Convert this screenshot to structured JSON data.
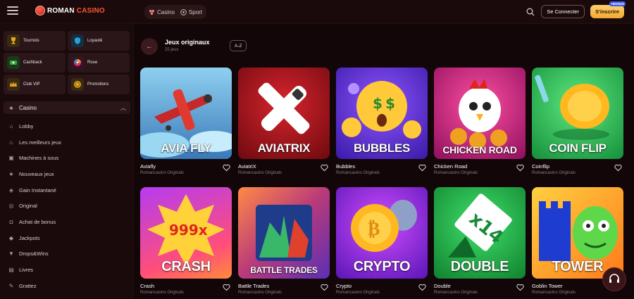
{
  "brand": {
    "part1": "ROMAN",
    "part2": "CASINO"
  },
  "header": {
    "tabs": [
      {
        "label": "Casino",
        "icon": "casino-icon"
      },
      {
        "label": "Sport",
        "icon": "soccer-ball-icon"
      }
    ],
    "login_label": "Se Connecter",
    "signup_label": "S'inscrire",
    "signup_badge": "+BONUS"
  },
  "sidebar": {
    "promos": [
      {
        "label": "Tournois",
        "icon": "trophy-icon",
        "color": "#e3a51f"
      },
      {
        "label": "Loyauté",
        "icon": "shield-icon",
        "color": "#2d9bd6"
      },
      {
        "label": "Cashback",
        "icon": "cash-icon",
        "color": "#39a23d"
      },
      {
        "label": "Roue",
        "icon": "wheel-icon",
        "color": "#d6326b"
      },
      {
        "label": "Club VIP",
        "icon": "crown-icon",
        "color": "#e3a51f"
      },
      {
        "label": "Promotions",
        "icon": "coin-icon",
        "color": "#e3a51f"
      }
    ],
    "casino_label": "Casino",
    "items": [
      {
        "label": "Lobby",
        "icon": "lobby-icon"
      },
      {
        "label": "Les meilleurs jeux",
        "icon": "flame-icon"
      },
      {
        "label": "Machines à sous",
        "icon": "slot-icon"
      },
      {
        "label": "Nouveaux jeux",
        "icon": "star-icon"
      },
      {
        "label": "Gain Instantané",
        "icon": "instant-icon"
      },
      {
        "label": "Original",
        "icon": "original-icon"
      },
      {
        "label": "Achat de bonus",
        "icon": "bag-icon"
      },
      {
        "label": "Jackpots",
        "icon": "jackpot-icon"
      },
      {
        "label": "Drops&Wins",
        "icon": "drops-icon"
      },
      {
        "label": "Livres",
        "icon": "book-icon"
      },
      {
        "label": "Grattez",
        "icon": "scratch-icon"
      }
    ]
  },
  "main": {
    "title": "Jeux originaux",
    "count": "25 jeux",
    "sort_label": "A-Z"
  },
  "games": [
    {
      "title": "Aviafly",
      "thumb_text": "AVIA FLY",
      "provider": "Romancasino Originals",
      "bg1": "#7ec3e8",
      "bg2": "#3a79b8"
    },
    {
      "title": "AviatriX",
      "thumb_text": "AVIATRIX",
      "provider": "Romancasino Originals",
      "bg1": "#c01a24",
      "bg2": "#6e0a10"
    },
    {
      "title": "Bubbles",
      "thumb_text": "BUBBLES",
      "provider": "Romancasino Originals",
      "bg1": "#7a3cf0",
      "bg2": "#3a1aa8"
    },
    {
      "title": "Chicken Road",
      "thumb_text": "CHICKEN ROAD",
      "provider": "Romancasino Originals",
      "bg1": "#ff3c8f",
      "bg2": "#a3126b"
    },
    {
      "title": "Coinflip",
      "thumb_text": "COIN FLIP",
      "provider": "Romancasino Originals",
      "bg1": "#3fd66a",
      "bg2": "#158f3b"
    },
    {
      "title": "Crash",
      "thumb_text": "CRASH",
      "provider": "Romancasino Originals",
      "bg1": "#b43cf2",
      "bg2": "#ff4e7a"
    },
    {
      "title": "Battle Trades",
      "thumb_text": "BATTLE TRADES",
      "provider": "Romancasino Originals",
      "bg1": "#ff7a45",
      "bg2": "#7b2fb5"
    },
    {
      "title": "Crypto",
      "thumb_text": "CRYPTO",
      "provider": "Romancasino Originals",
      "bg1": "#c23cf5",
      "bg2": "#5a16b8"
    },
    {
      "title": "Double",
      "thumb_text": "DOUBLE",
      "provider": "Romancasino Originals",
      "bg1": "#2fd35a",
      "bg2": "#11812f"
    },
    {
      "title": "Goblin Tower",
      "thumb_text": "TOWER",
      "provider": "Romancasino Originals",
      "bg1": "#ffb428",
      "bg2": "#e0621a"
    }
  ]
}
